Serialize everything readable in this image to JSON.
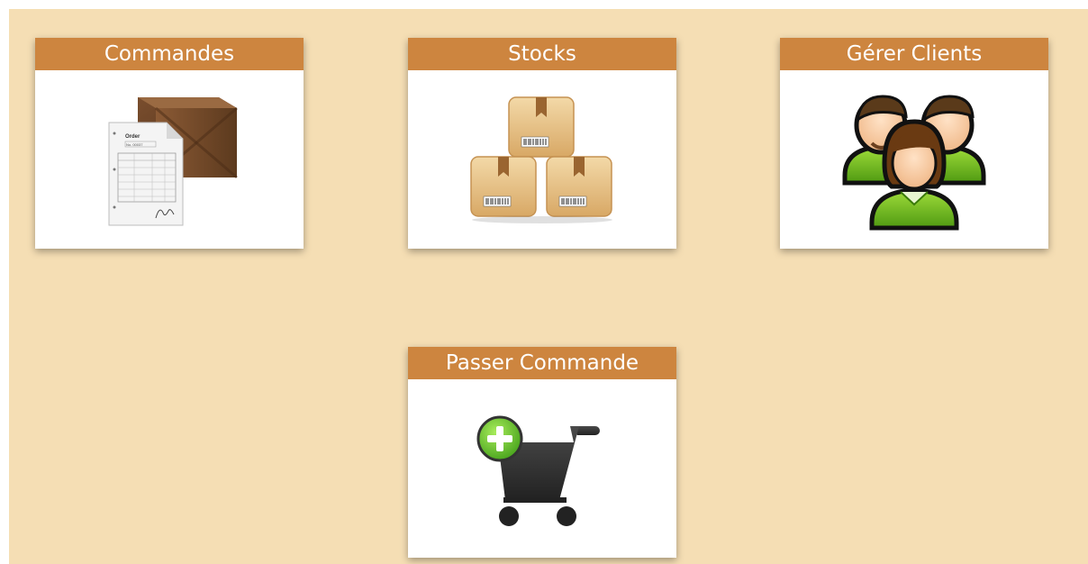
{
  "tiles": [
    {
      "label": "Commandes",
      "icon": "order-box-icon",
      "order_text": "Order",
      "order_no": "No. 00037"
    },
    {
      "label": "Stocks",
      "icon": "stock-boxes-icon"
    },
    {
      "label": "Gérer Clients",
      "icon": "clients-group-icon"
    },
    {
      "label": "Passer Commande",
      "icon": "cart-add-icon"
    }
  ],
  "colors": {
    "background": "#f5deb4",
    "header": "#cd853f",
    "tile": "#ffffff"
  }
}
